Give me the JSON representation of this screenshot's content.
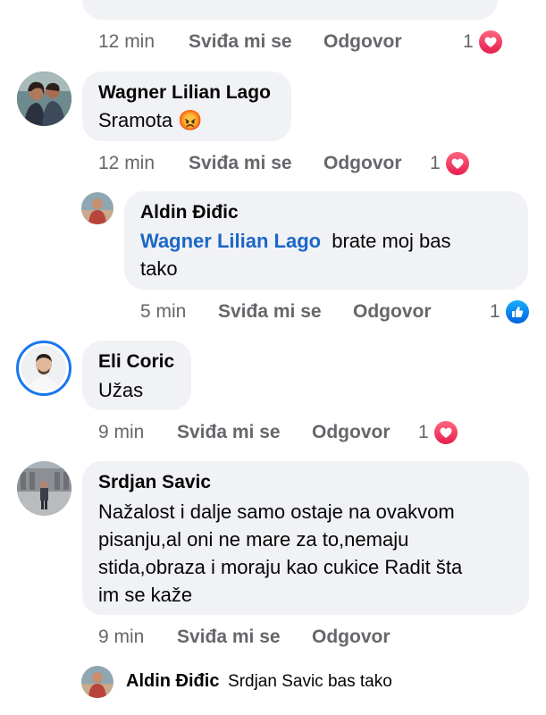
{
  "top_comment": {
    "time": "12 min",
    "like_label": "Sviđa mi se",
    "reply_label": "Odgovor",
    "reaction_count": "1",
    "reaction_icon": "heart-icon"
  },
  "comments": [
    {
      "author": "Wagner Lilian Lago",
      "text": "Sramota",
      "emoji": "😡",
      "time": "12 min",
      "like_label": "Sviđa mi se",
      "reply_label": "Odgovor",
      "reaction_count": "1",
      "reaction_icon": "heart-icon"
    },
    {
      "author": "Aldin Điđic",
      "mention": "Wagner Lilian Lago",
      "text_line1": "brate moj bas",
      "text_line2": "tako",
      "time": "5 min",
      "like_label": "Sviđa mi se",
      "reply_label": "Odgovor",
      "reaction_count": "1",
      "reaction_icon": "like-icon"
    },
    {
      "author": "Eli Coric",
      "text": "Užas",
      "time": "9 min",
      "like_label": "Sviđa mi se",
      "reply_label": "Odgovor",
      "reaction_count": "1",
      "reaction_icon": "heart-icon"
    },
    {
      "author": "Srdjan Savic",
      "lines": [
        "Nažalost i dalje samo ostaje na ovakvom",
        "pisanju,al oni ne mare za to,nemaju",
        "stida,obraza i moraju kao cukice Radit šta",
        "im se kaže"
      ],
      "time": "9 min",
      "like_label": "Sviđa mi se",
      "reply_label": "Odgovor"
    }
  ],
  "reply_preview": {
    "author": "Aldin Điđic",
    "text": "Srdjan Savic bas tako"
  },
  "colors": {
    "bubble": "#f0f2f5",
    "secondary_text": "#65676b",
    "mention": "#1b66c9",
    "heart": "#e61e4d",
    "like": "#0866ff"
  }
}
